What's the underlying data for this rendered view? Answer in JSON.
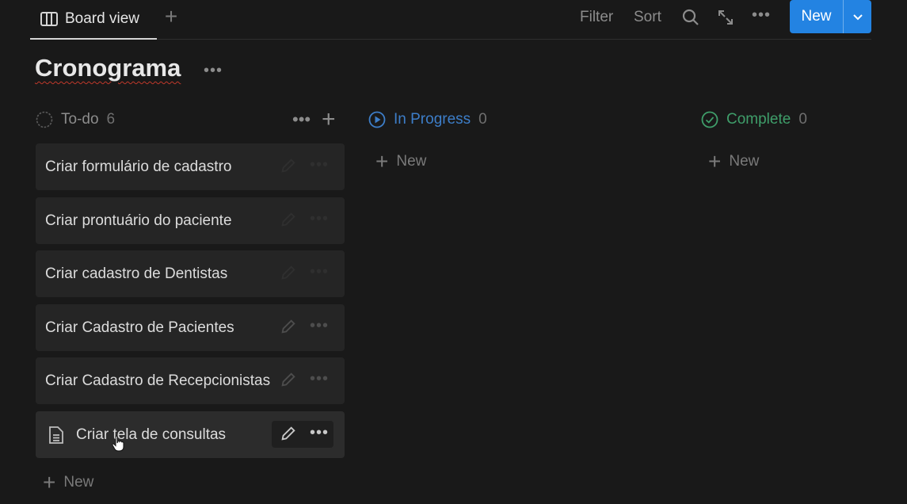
{
  "topbar": {
    "view_tab_label": "Board view",
    "filter_label": "Filter",
    "sort_label": "Sort",
    "new_label": "New"
  },
  "page": {
    "title": "Cronograma"
  },
  "columns": [
    {
      "name": "To-do",
      "count": "6",
      "color": "#8c8c8c"
    },
    {
      "name": "In Progress",
      "count": "0",
      "color": "#3d7ec9"
    },
    {
      "name": "Complete",
      "count": "0",
      "color": "#3f9e6a"
    }
  ],
  "todo_cards": [
    "Criar formulário de cadastro",
    "Criar prontuário do paciente",
    "Criar cadastro de Dentistas",
    "Criar Cadastro de Pacientes",
    "Criar Cadastro de Recepcionistas",
    "Criar tela de consultas"
  ],
  "new_labels": {
    "todo": "New",
    "in_progress": "New",
    "complete": "New"
  },
  "icons": {
    "board": "board-view-icon",
    "search": "search-icon",
    "expand": "expand-icon",
    "more": "more-icon",
    "doc": "document-icon",
    "edit": "pencil-icon"
  }
}
